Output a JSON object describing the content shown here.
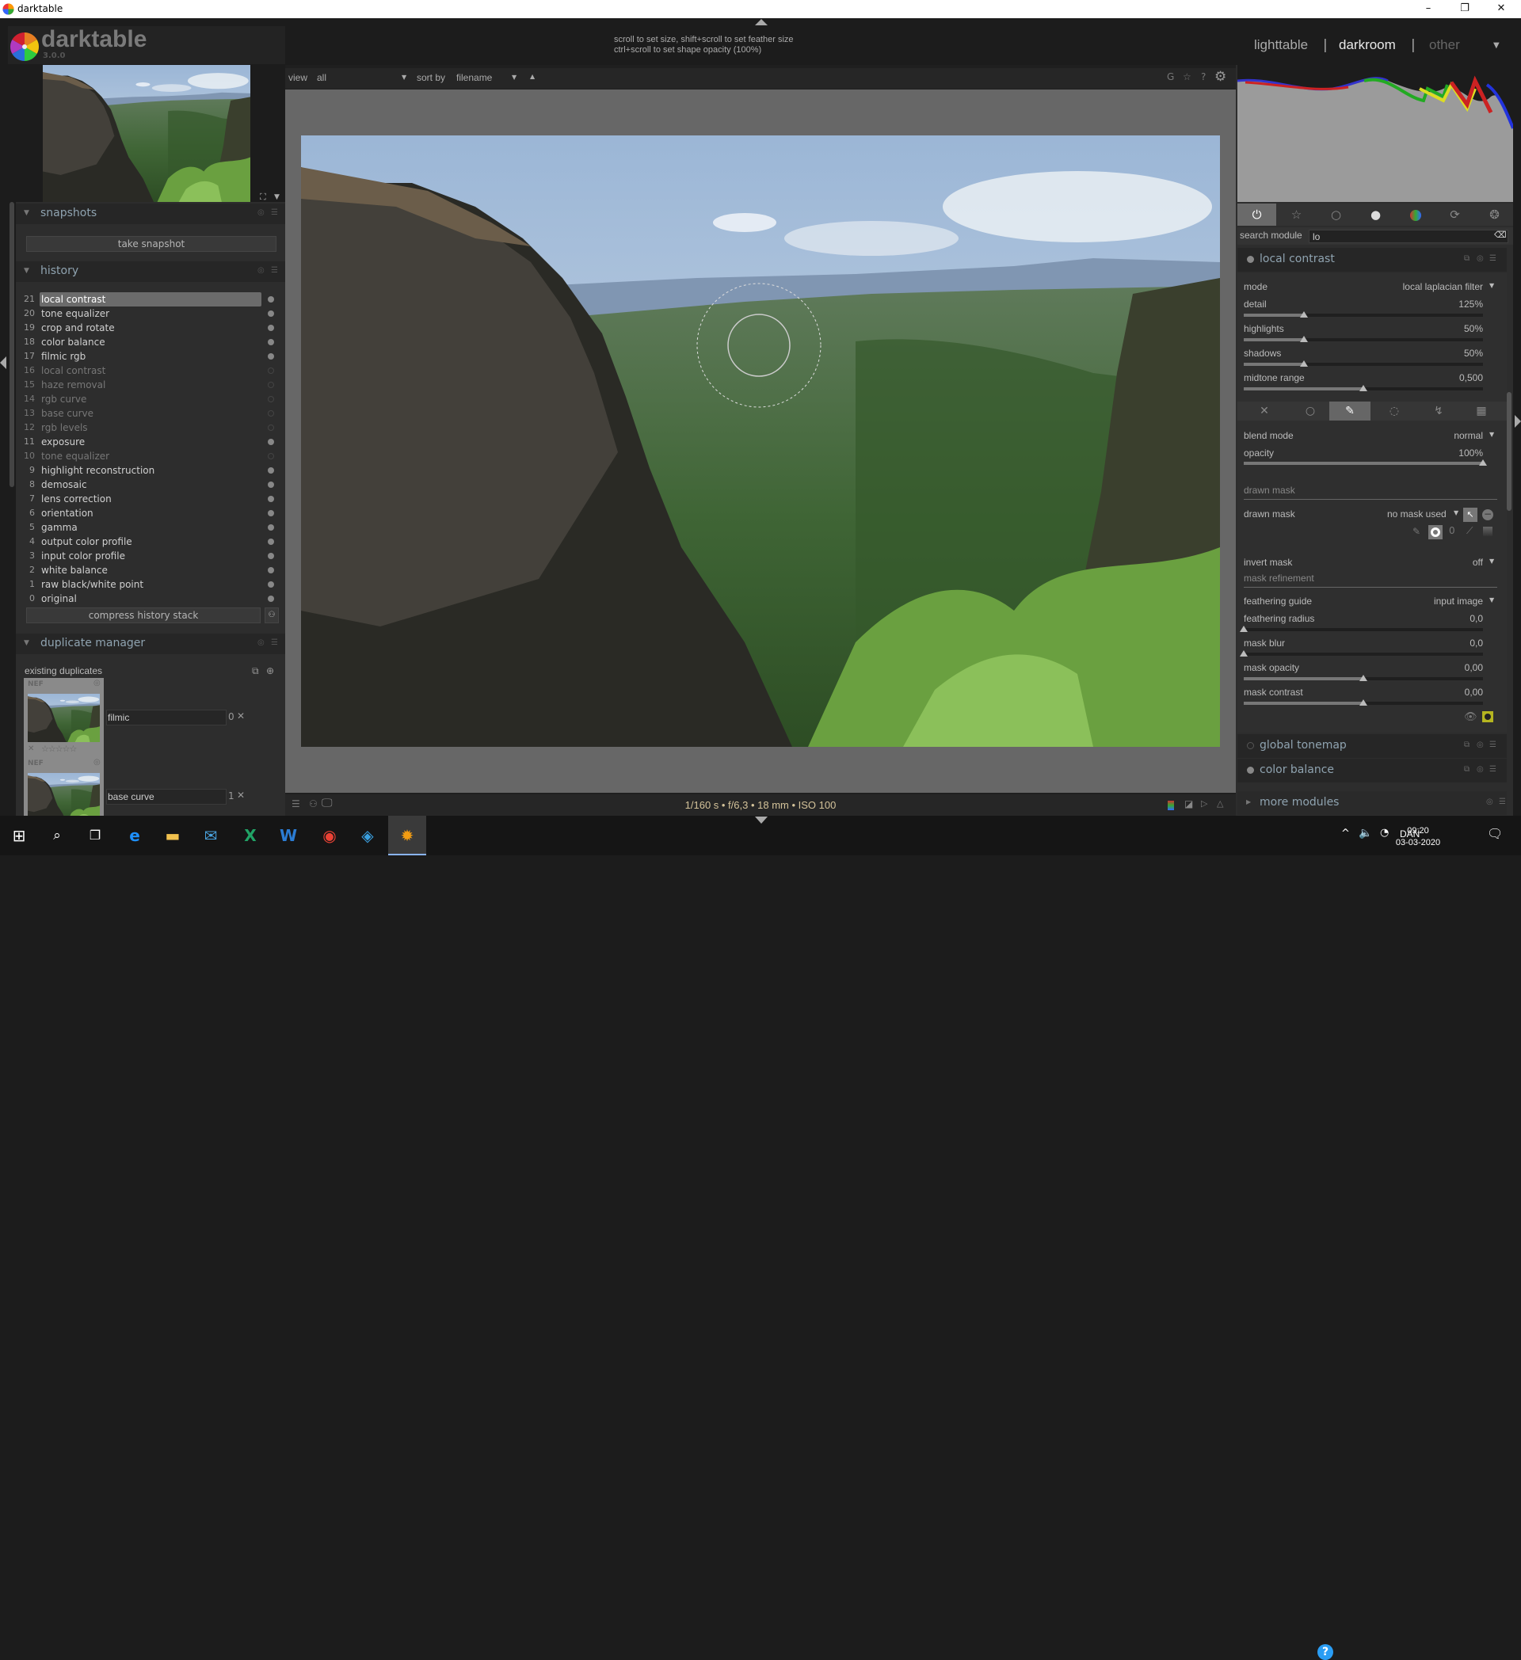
{
  "window": {
    "title": "darktable",
    "minimize": "–",
    "maximize": "❐",
    "close": "✕"
  },
  "header": {
    "logo_text": "darktable",
    "version": "3.0.0",
    "hint_line1": "scroll to set size, shift+scroll to set feather size",
    "hint_line2": "ctrl+scroll to set shape opacity (100%)",
    "views": [
      "lighttable",
      "darkroom",
      "other"
    ],
    "active_view": "darkroom",
    "separator": "|"
  },
  "left": {
    "snapshots": {
      "title": "snapshots",
      "take_snapshot": "take snapshot"
    },
    "history": {
      "title": "history",
      "items": [
        {
          "n": "21",
          "name": "local contrast",
          "enabled": true,
          "selected": true
        },
        {
          "n": "20",
          "name": "tone equalizer",
          "enabled": true
        },
        {
          "n": "19",
          "name": "crop and rotate",
          "enabled": true
        },
        {
          "n": "18",
          "name": "color balance",
          "enabled": true
        },
        {
          "n": "17",
          "name": "filmic rgb",
          "enabled": true
        },
        {
          "n": "16",
          "name": "local contrast",
          "enabled": false
        },
        {
          "n": "15",
          "name": "haze removal",
          "enabled": false
        },
        {
          "n": "14",
          "name": "rgb curve",
          "enabled": false
        },
        {
          "n": "13",
          "name": "base curve",
          "enabled": false
        },
        {
          "n": "12",
          "name": "rgb levels",
          "enabled": false
        },
        {
          "n": "11",
          "name": "exposure",
          "enabled": true
        },
        {
          "n": "10",
          "name": "tone equalizer",
          "enabled": false
        },
        {
          "n": "9",
          "name": "highlight reconstruction",
          "enabled": true
        },
        {
          "n": "8",
          "name": "demosaic",
          "enabled": true
        },
        {
          "n": "7",
          "name": "lens correction",
          "enabled": true
        },
        {
          "n": "6",
          "name": "orientation",
          "enabled": true
        },
        {
          "n": "5",
          "name": "gamma",
          "enabled": true
        },
        {
          "n": "4",
          "name": "output color profile",
          "enabled": true
        },
        {
          "n": "3",
          "name": "input color profile",
          "enabled": true
        },
        {
          "n": "2",
          "name": "white balance",
          "enabled": true
        },
        {
          "n": "1",
          "name": "raw black/white point",
          "enabled": true
        },
        {
          "n": "0",
          "name": "original",
          "enabled": true
        }
      ],
      "compress": "compress history stack"
    },
    "duplicates": {
      "title": "duplicate manager",
      "existing": "existing duplicates",
      "items": [
        {
          "tag": "NEF",
          "name": "filmic",
          "version": "0",
          "rating": "☆☆☆☆☆",
          "reject": "✕"
        },
        {
          "tag": "NEF",
          "name": "base curve",
          "version": "1"
        }
      ]
    }
  },
  "center": {
    "toolbar": {
      "view_label": "view",
      "view_value": "all",
      "sort_label": "sort by",
      "sort_value": "filename"
    },
    "exif": "1/160 s • f/6,3 • 18 mm • ISO 100"
  },
  "right": {
    "search_label": "search module",
    "search_value": "lo",
    "module": {
      "title": "local contrast",
      "mode_label": "mode",
      "mode_value": "local laplacian filter",
      "sliders": [
        {
          "label": "detail",
          "value": "125%",
          "fraction": 0.25
        },
        {
          "label": "highlights",
          "value": "50%",
          "fraction": 0.25
        },
        {
          "label": "shadows",
          "value": "50%",
          "fraction": 0.25
        },
        {
          "label": "midtone range",
          "value": "0,500",
          "fraction": 0.5
        }
      ],
      "blend_mode_label": "blend mode",
      "blend_mode_value": "normal",
      "opacity_label": "opacity",
      "opacity_value": "100%",
      "opacity_fraction": 1.0,
      "drawn_mask_section": "drawn mask",
      "drawn_mask_label": "drawn mask",
      "drawn_mask_value": "no mask used",
      "shape_count": "0",
      "invert_label": "invert mask",
      "invert_value": "off",
      "refinement_section": "mask refinement",
      "feather_guide_label": "feathering guide",
      "feather_guide_value": "input image",
      "refine_sliders": [
        {
          "label": "feathering radius",
          "value": "0,0",
          "fraction": 0
        },
        {
          "label": "mask blur",
          "value": "0,0",
          "fraction": 0
        },
        {
          "label": "mask opacity",
          "value": "0,00",
          "fraction": 0.5
        },
        {
          "label": "mask contrast",
          "value": "0,00",
          "fraction": 0.5
        }
      ]
    },
    "other_modules": [
      "global tonemap",
      "color balance"
    ],
    "more_modules": "more modules"
  },
  "taskbar": {
    "language": "DAN",
    "time": "09:20",
    "date": "03-03-2020"
  },
  "colors": {
    "accent_header": "#8fa3b0",
    "exif": "#d4c39a",
    "mask_indicator": "#b5b520"
  }
}
